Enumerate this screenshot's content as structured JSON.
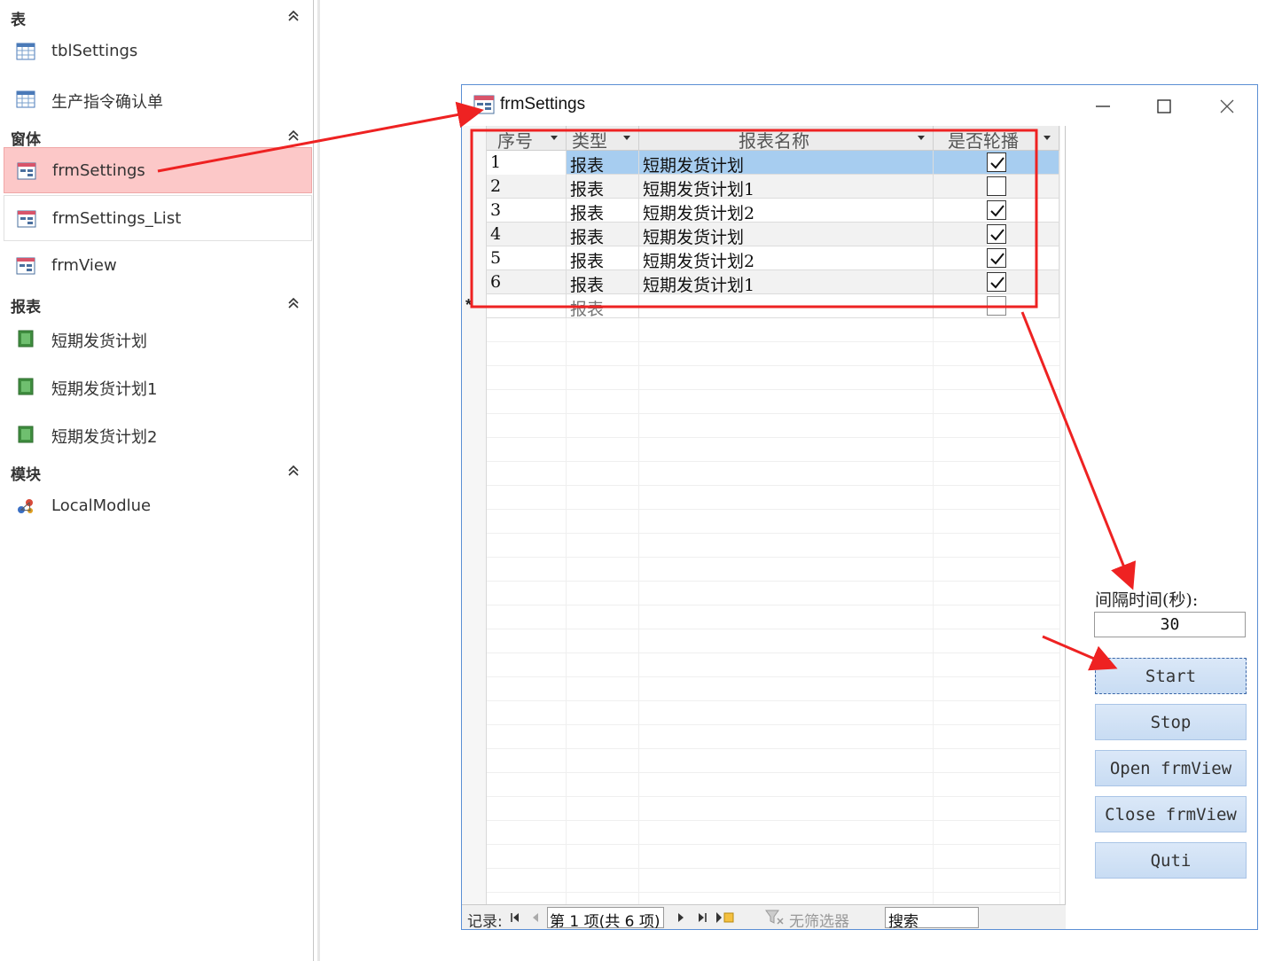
{
  "nav": {
    "groups": [
      {
        "title": "表"
      },
      {
        "title": "窗体"
      },
      {
        "title": "报表"
      },
      {
        "title": "模块"
      }
    ],
    "items": {
      "tbl_settings": "tblSettings",
      "tbl_confirm": "生产指令确认单",
      "frm_settings": "frmSettings",
      "frm_settings_list": "frmSettings_List",
      "frm_view": "frmView",
      "rpt_1": "短期发货计划",
      "rpt_2": "短期发货计划1",
      "rpt_3": "短期发货计划2",
      "mod_1": "LocalModlue"
    }
  },
  "window": {
    "title": "frmSettings"
  },
  "sheet": {
    "columns": [
      "序号",
      "类型",
      "报表名称",
      "是否轮播"
    ],
    "rows": [
      {
        "id": "1",
        "type": "报表",
        "name": "短期发货计划",
        "checked": true
      },
      {
        "id": "2",
        "type": "报表",
        "name": "短期发货计划1",
        "checked": false
      },
      {
        "id": "3",
        "type": "报表",
        "name": "短期发货计划2",
        "checked": true
      },
      {
        "id": "4",
        "type": "报表",
        "name": "短期发货计划",
        "checked": true
      },
      {
        "id": "5",
        "type": "报表",
        "name": "短期发货计划2",
        "checked": true
      },
      {
        "id": "6",
        "type": "报表",
        "name": "短期发货计划1",
        "checked": true
      }
    ],
    "new_row": {
      "mark": "*",
      "type": "报表"
    }
  },
  "status": {
    "record_label": "记录:",
    "record_value": "第 1 项(共 6 项)",
    "filter": "无筛选器",
    "search": "搜索"
  },
  "panel": {
    "interval_label": "间隔时间(秒):",
    "interval_value": "30",
    "buttons": {
      "start": "Start",
      "stop": "Stop",
      "open": "Open frmView",
      "close": "Close frmView",
      "quit": "Quti"
    }
  },
  "colors": {
    "selection_row": "#a7cdf0",
    "nav_selected": "#fcc8c8",
    "annotation_red": "#ee2222",
    "window_border": "#5b8fd4"
  },
  "icons": {
    "table": "table-icon",
    "form": "form-icon",
    "report": "report-icon",
    "module": "module-icon",
    "chevron": "chevron-up-double-icon"
  }
}
